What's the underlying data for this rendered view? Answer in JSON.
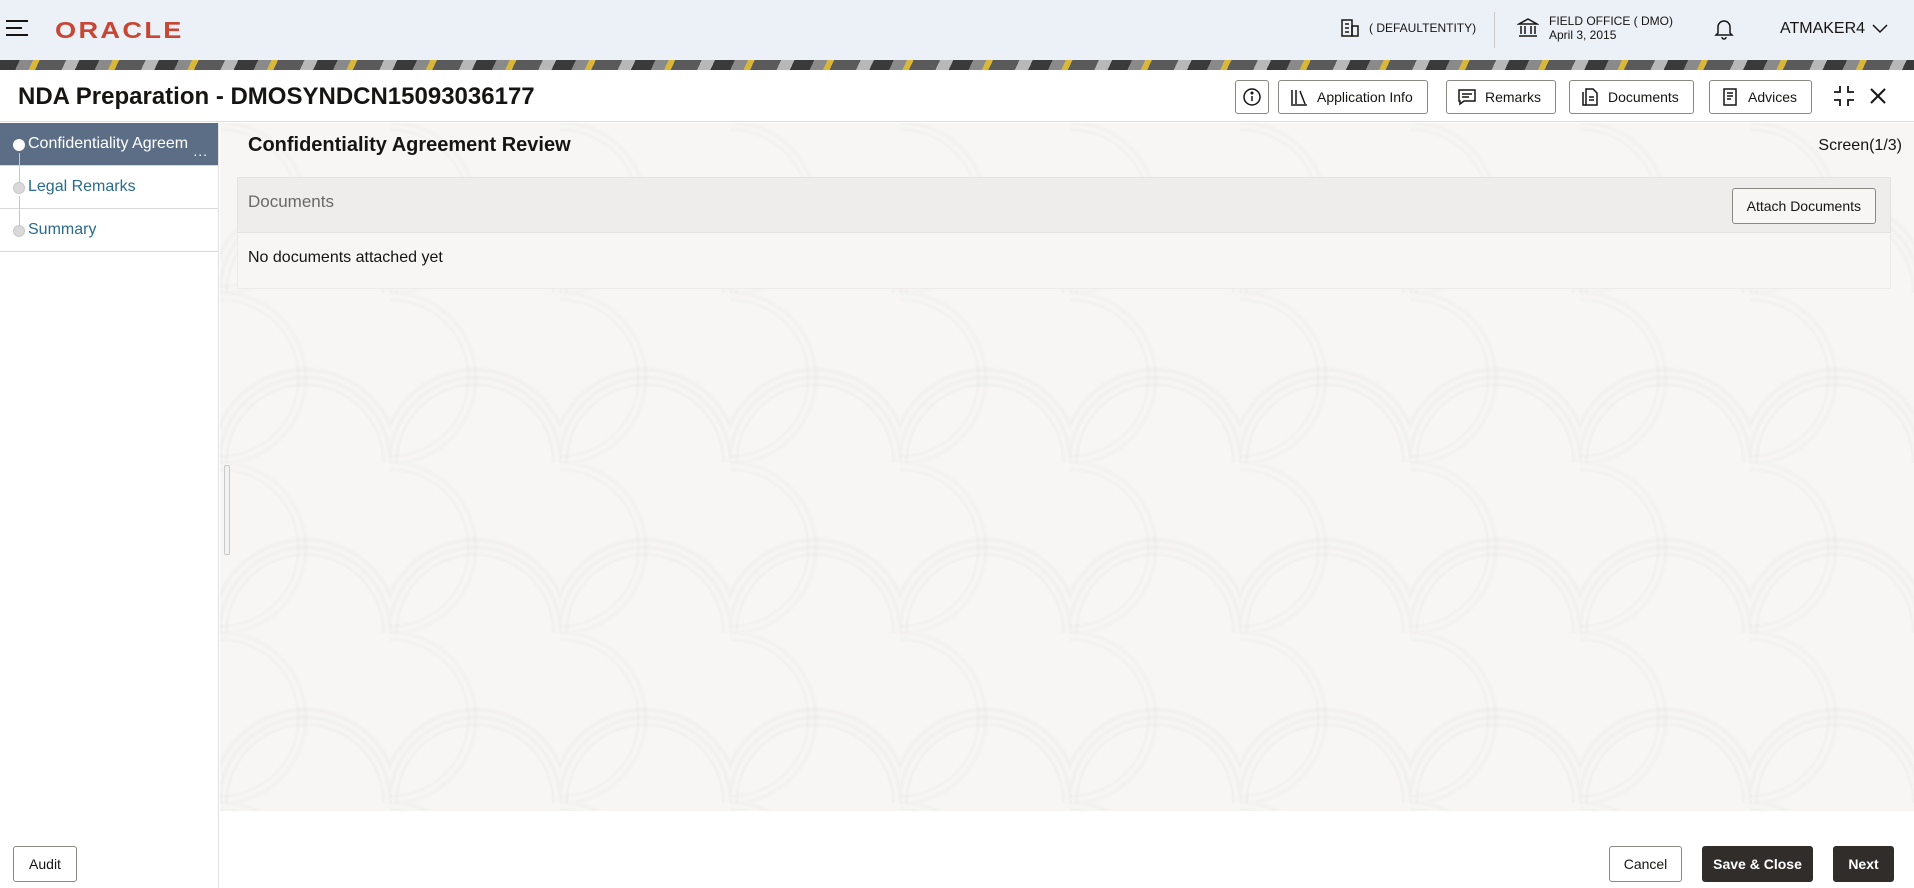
{
  "header": {
    "logo": "ORACLE",
    "entity": "( DEFAULTENTITY)",
    "office_name": "FIELD OFFICE ( DMO)",
    "office_date": "April 3, 2015",
    "user": "ATMAKER4"
  },
  "window": {
    "title": "NDA Preparation - DMOSYNDCN15093036177",
    "toolbar": {
      "application_info": "Application Info",
      "remarks": "Remarks",
      "documents": "Documents",
      "advices": "Advices"
    }
  },
  "nav": {
    "items": [
      {
        "label": "Confidentiality Agreem",
        "more": "...",
        "active": true
      },
      {
        "label": "Legal Remarks",
        "active": false
      },
      {
        "label": "Summary",
        "active": false
      }
    ]
  },
  "main": {
    "section_title": "Confidentiality Agreement Review",
    "screen": "Screen(1/3)",
    "documents_label": "Documents",
    "attach_button": "Attach Documents",
    "empty_text": "No documents attached yet"
  },
  "footer": {
    "audit": "Audit",
    "cancel": "Cancel",
    "save_close": "Save & Close",
    "next": "Next"
  },
  "colors": {
    "brand": "#c74634",
    "active_nav": "#5c6e86",
    "primary_button": "#312d2a",
    "link": "#2a6a8c"
  }
}
